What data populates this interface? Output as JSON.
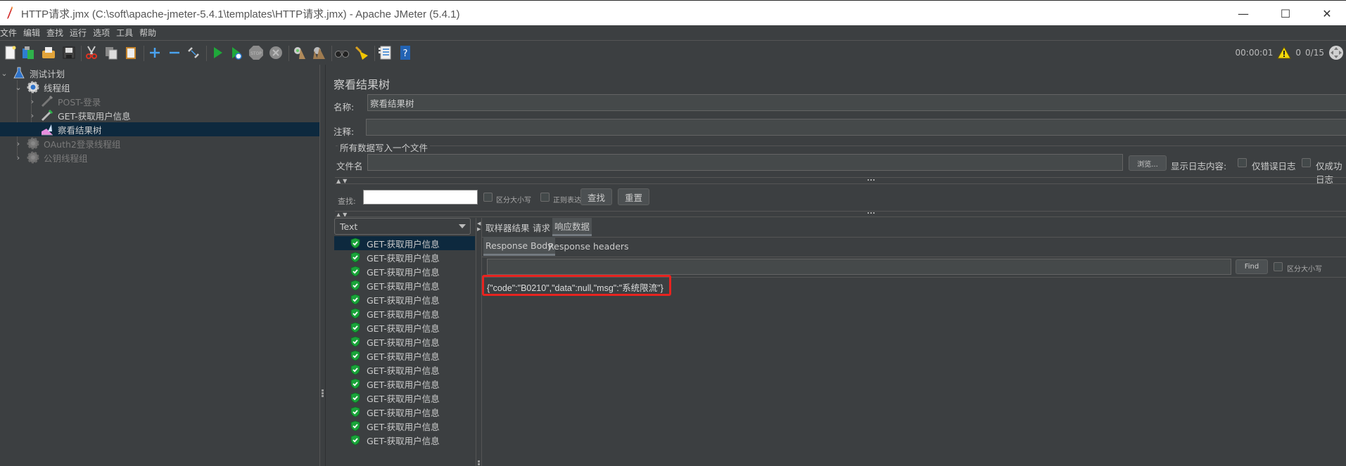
{
  "window": {
    "title": "HTTP请求.jmx (C:\\soft\\apache-jmeter-5.4.1\\templates\\HTTP请求.jmx) - Apache JMeter (5.4.1)",
    "minimize": "—",
    "maximize": "☐",
    "close": "✕"
  },
  "menu": [
    "文件",
    "编辑",
    "查找",
    "运行",
    "选项",
    "工具",
    "帮助"
  ],
  "toolbar": {
    "icons": [
      "new-icon",
      "templates-icon",
      "open-icon",
      "save-icon",
      "cut-icon",
      "copy-icon",
      "paste-icon",
      "expand-icon",
      "collapse-icon",
      "toggle-icon",
      "start-icon",
      "start-no-pause-icon",
      "stop-icon",
      "shutdown-icon",
      "clear-icon",
      "clear-all-icon",
      "search-icon",
      "reset-search-icon",
      "function-helper-icon",
      "help-icon"
    ]
  },
  "status": {
    "elapsed": "00:00:01",
    "warnings": "0",
    "threads": "0/15"
  },
  "tree": {
    "items": [
      {
        "label": "测试计划",
        "level": 0,
        "expanded": true,
        "icon": "test-plan-icon",
        "enabled": true
      },
      {
        "label": "线程组",
        "level": 1,
        "expanded": true,
        "icon": "thread-group-icon",
        "enabled": true
      },
      {
        "label": "POST-登录",
        "level": 2,
        "expanded": false,
        "icon": "sampler-icon",
        "enabled": false
      },
      {
        "label": "GET-获取用户信息",
        "level": 2,
        "expanded": false,
        "icon": "sampler-icon",
        "enabled": true
      },
      {
        "label": "察看结果树",
        "level": 2,
        "icon": "listener-icon",
        "enabled": true,
        "selected": true
      },
      {
        "label": "OAuth2登录线程组",
        "level": 1,
        "expanded": false,
        "icon": "thread-group-icon",
        "enabled": false
      },
      {
        "label": "公钥线程组",
        "level": 1,
        "expanded": false,
        "icon": "thread-group-icon",
        "enabled": false
      }
    ]
  },
  "panel": {
    "title": "察看结果树",
    "name_label": "名称:",
    "name_value": "察看结果树",
    "comment_label": "注释:",
    "comment_value": "",
    "file_group_label": "所有数据写入一个文件",
    "filename_label": "文件名",
    "filename_value": "",
    "browse_button": "浏览...",
    "log_label": "显示日志内容:",
    "errors_only": "仅错误日志",
    "success_only": "仅成功日志",
    "search_label": "查找:",
    "search_value": "",
    "case_sensitive": "区分大小写",
    "regex": "正则表达式",
    "find_button": "查找",
    "reset_button": "重置"
  },
  "results": {
    "renderer": "Text",
    "items": [
      "GET-获取用户信息",
      "GET-获取用户信息",
      "GET-获取用户信息",
      "GET-获取用户信息",
      "GET-获取用户信息",
      "GET-获取用户信息",
      "GET-获取用户信息",
      "GET-获取用户信息",
      "GET-获取用户信息",
      "GET-获取用户信息",
      "GET-获取用户信息",
      "GET-获取用户信息",
      "GET-获取用户信息",
      "GET-获取用户信息",
      "GET-获取用户信息"
    ],
    "selected_index": 0,
    "status_icon": "success-shield-icon"
  },
  "detail": {
    "tabs": [
      "取样器结果",
      "请求",
      "响应数据"
    ],
    "active_tab": 2,
    "subtabs": [
      "Response Body",
      "Response headers"
    ],
    "active_subtab": 0,
    "find_value": "",
    "find_button": "Find",
    "case_sensitive": "区分大小写",
    "response_body": "{\"code\":\"B0210\",\"data\":null,\"msg\":\"系统限流\"}",
    "highlight_color": "#e8231f"
  }
}
